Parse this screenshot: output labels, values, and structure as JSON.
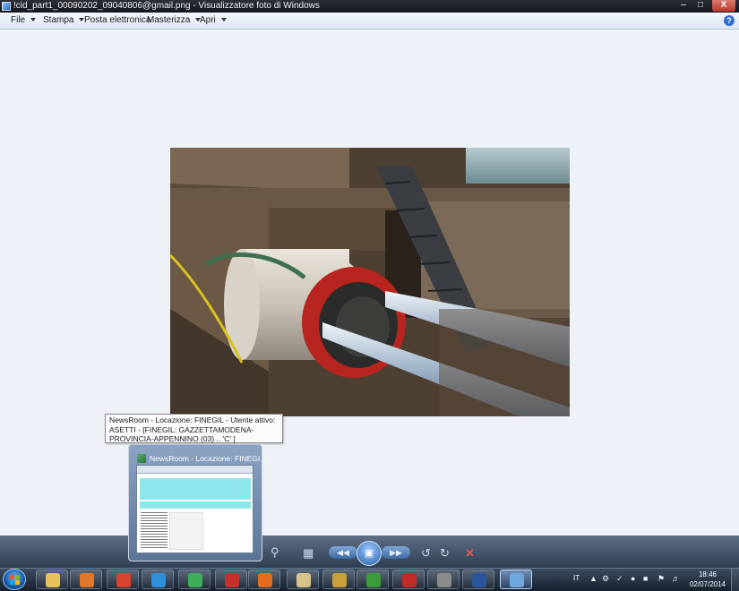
{
  "window": {
    "title": "!cid_part1_00090202_09040806@gmail.png - Visualizzatore foto di Windows",
    "minimize": "–",
    "maximize": "□",
    "close": "X"
  },
  "menu": {
    "file": "File",
    "stampa": "Stampa",
    "posta": "Posta elettronica",
    "masterizza": "Masterizza",
    "apri": "Apri",
    "help": "?"
  },
  "photo": {
    "subject": "tunnel boring machine in excavation pit"
  },
  "controls": {
    "zoom_icon": "magnifier-icon",
    "fit_icon": "actual-size-icon",
    "prev": "◀◀",
    "play": "▣",
    "next": "▶▶",
    "rotate_ccw_icon": "rotate-left-icon",
    "rotate_cw_icon": "rotate-right-icon",
    "delete_icon": "delete-icon"
  },
  "tooltip": {
    "text": "NewsRoom - Locazione: FINEGIL - Utente attivo: ASETTI - [FINEGIL: GAZZETTAMODENA-PROVINCIA-APPENNINO (03) ..   'C'  ]"
  },
  "preview": {
    "title": "NewsRoom - Locazione: FINEGI..."
  },
  "taskbar": {
    "items": [
      {
        "name": "explorer",
        "icon": "folder-icon",
        "color": "#e8c25a"
      },
      {
        "name": "media-player",
        "icon": "media-player-icon",
        "color": "#e0782a"
      },
      {
        "name": "chrome",
        "icon": "chrome-icon",
        "color": "#d9432f"
      },
      {
        "name": "internet-explorer",
        "icon": "ie-icon",
        "color": "#2f8fd9"
      },
      {
        "name": "newsroom",
        "icon": "newsroom-icon",
        "color": "#3fae5a"
      },
      {
        "name": "app-red",
        "icon": "red-app-icon",
        "color": "#c8302b"
      },
      {
        "name": "firefox",
        "icon": "firefox-icon",
        "color": "#e46b1f"
      },
      {
        "name": "files",
        "icon": "files-icon",
        "color": "#d7c48a"
      },
      {
        "name": "tool",
        "icon": "tool-icon",
        "color": "#c9a13a"
      },
      {
        "name": "game",
        "icon": "green-app-icon",
        "color": "#3c9b3c"
      },
      {
        "name": "md",
        "icon": "md-app-icon",
        "color": "#c22a2a"
      },
      {
        "name": "settings",
        "icon": "gear-app-icon",
        "color": "#8c8c8c"
      },
      {
        "name": "word",
        "icon": "word-icon",
        "color": "#2b579a"
      },
      {
        "name": "photo-viewer",
        "icon": "photo-viewer-icon",
        "color": "#6fa8dc"
      }
    ],
    "language": "IT",
    "time": "18:46",
    "date": "02/07/2014"
  }
}
